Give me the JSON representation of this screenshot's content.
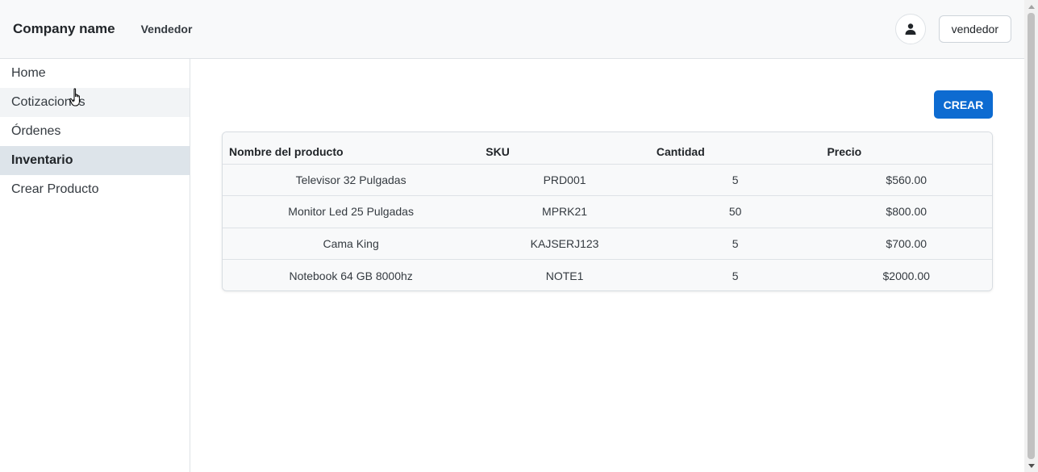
{
  "header": {
    "brand": "Company name",
    "role": "Vendedor",
    "user_button": "vendedor",
    "avatar_icon": "person-icon"
  },
  "sidebar": {
    "items": [
      {
        "label": "Home"
      },
      {
        "label": "Cotizaciones"
      },
      {
        "label": "Órdenes"
      },
      {
        "label": "Inventario"
      },
      {
        "label": "Crear Producto"
      }
    ]
  },
  "main": {
    "create_button": "CREAR",
    "table": {
      "headers": [
        "Nombre del producto",
        "SKU",
        "Cantidad",
        "Precio"
      ],
      "rows": [
        [
          "Televisor 32 Pulgadas",
          "PRD001",
          "5",
          "$560.00"
        ],
        [
          "Monitor Led 25 Pulgadas",
          "MPRK21",
          "50",
          "$800.00"
        ],
        [
          "Cama King",
          "KAJSERJ123",
          "5",
          "$700.00"
        ],
        [
          "Notebook 64 GB 8000hz",
          "NOTE1",
          "5",
          "$2000.00"
        ]
      ]
    }
  },
  "colors": {
    "primary": "#0d6bd1",
    "active_nav": "#dde4ea",
    "topbar": "#f8f9fa"
  }
}
